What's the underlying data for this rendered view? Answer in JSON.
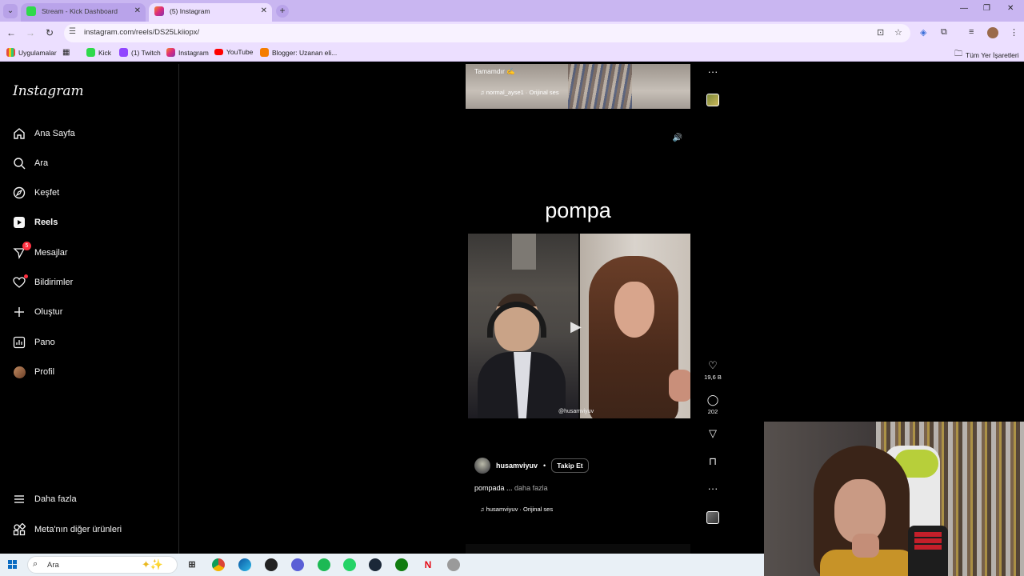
{
  "browser": {
    "tabs": [
      {
        "title": "Stream - Kick Dashboard",
        "active": false,
        "favicon": "kick-icon"
      },
      {
        "title": "(5) Instagram",
        "active": true,
        "favicon": "instagram-icon"
      }
    ],
    "url": "instagram.com/reels/DS25Lkiiopx/",
    "bookmarks": [
      {
        "label": "Uygulamalar",
        "icon": "apps-grid-icon"
      },
      {
        "label": "",
        "icon": "grid-icon"
      },
      {
        "label": "Kick",
        "icon": "kick-icon"
      },
      {
        "label": "(1) Twitch",
        "icon": "twitch-icon"
      },
      {
        "label": "Instagram",
        "icon": "instagram-icon"
      },
      {
        "label": "YouTube",
        "icon": "youtube-icon"
      },
      {
        "label": "Blogger: Uzanan eli...",
        "icon": "blogger-icon"
      }
    ],
    "all_bookmarks": "Tüm Yer İşaretleri"
  },
  "sidebar": {
    "logo": "Instagram",
    "items": [
      {
        "label": "Ana Sayfa",
        "icon": "home-icon"
      },
      {
        "label": "Ara",
        "icon": "search-icon"
      },
      {
        "label": "Keşfet",
        "icon": "compass-icon"
      },
      {
        "label": "Reels",
        "icon": "reels-icon",
        "active": true
      },
      {
        "label": "Mesajlar",
        "icon": "messenger-icon",
        "badge": "5"
      },
      {
        "label": "Bildirimler",
        "icon": "heart-icon"
      },
      {
        "label": "Oluştur",
        "icon": "plus-icon"
      },
      {
        "label": "Pano",
        "icon": "dashboard-icon"
      },
      {
        "label": "Profil",
        "icon": "avatar"
      }
    ],
    "more": "Daha fazla",
    "meta": "Meta'nın diğer ürünleri"
  },
  "prev_reel": {
    "caption": "Tamamdır",
    "audio": "normal_ayse1 · Orijinal ses"
  },
  "reel": {
    "overlay_title": "pompa",
    "watermark": "@husamviyuv",
    "username": "husamviyuv",
    "separator": "•",
    "follow": "Takip Et",
    "caption": "pompada ...",
    "caption_more": "daha fazla",
    "audio": "husamviyuv · Orijinal ses",
    "likes": "19,6 B",
    "comments": "202"
  },
  "taskbar": {
    "search_placeholder": "Ara",
    "apps": [
      "task-view-icon",
      "chrome-icon",
      "edge-icon",
      "app-icon",
      "app-icon",
      "spotify-icon",
      "whatsapp-icon",
      "steam-icon",
      "xbox-icon",
      "netflix-icon",
      "app-icon"
    ]
  },
  "colors": {
    "chrome_frame": "#c9b6f1",
    "chrome_toolbar": "#ecdfff",
    "ig_bg": "#000000",
    "badge": "#ff3040"
  }
}
